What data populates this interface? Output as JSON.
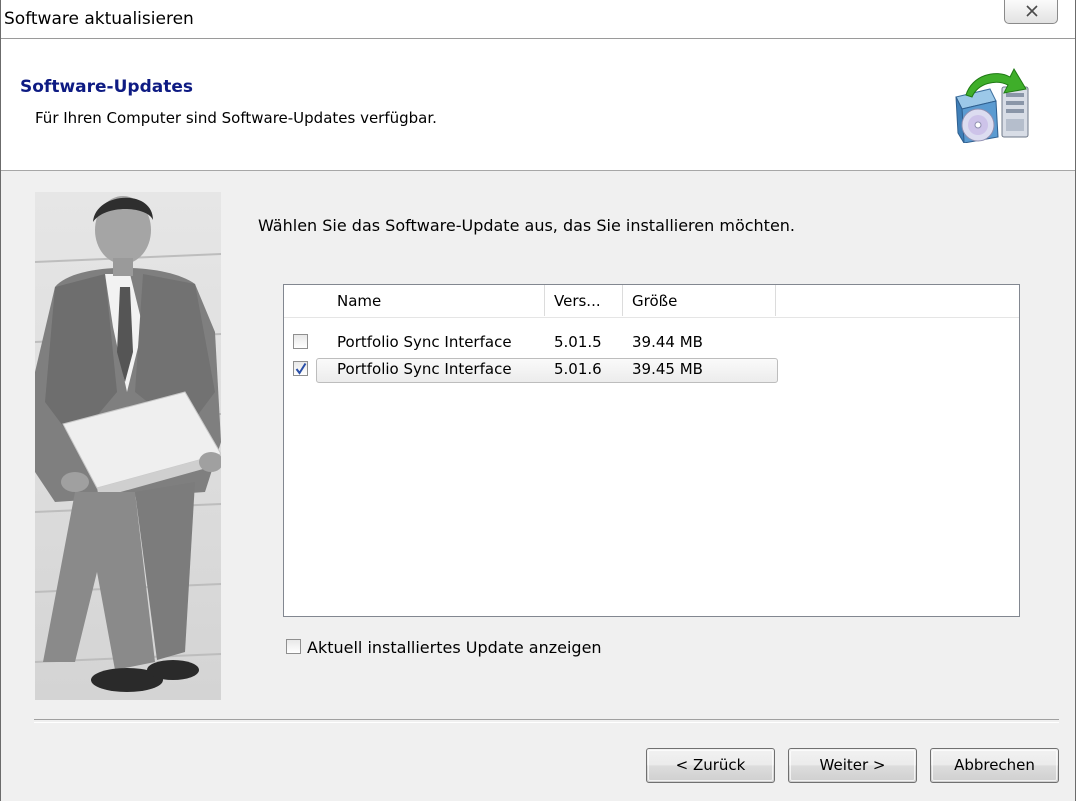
{
  "window": {
    "title": "Software aktualisieren"
  },
  "header": {
    "title": "Software-Updates",
    "subtitle": "Für Ihren Computer sind Software-Updates verfügbar."
  },
  "main": {
    "instruction": "Wählen Sie das Software-Update aus, das Sie installieren möchten.",
    "columns": [
      "Name",
      "Vers...",
      "Größe"
    ],
    "rows": [
      {
        "name": "Portfolio Sync Interface",
        "version": "5.01.5",
        "size": "39.44 MB",
        "checked": false,
        "selected": false
      },
      {
        "name": "Portfolio Sync Interface",
        "version": "5.01.6",
        "size": "39.45 MB",
        "checked": true,
        "selected": true
      }
    ],
    "show_current_label": "Aktuell installiertes Update anzeigen",
    "show_current_checked": false
  },
  "buttons": {
    "back": "< Zurück",
    "next": "Weiter >",
    "cancel": "Abbrechen"
  },
  "icons": {
    "close": "close-icon",
    "header": "software-update-icon",
    "checkmark": "checkmark-icon"
  },
  "colors": {
    "header_title": "#0e1b83",
    "content_bg": "#f0f0f0",
    "check": "#2a4fa8"
  }
}
